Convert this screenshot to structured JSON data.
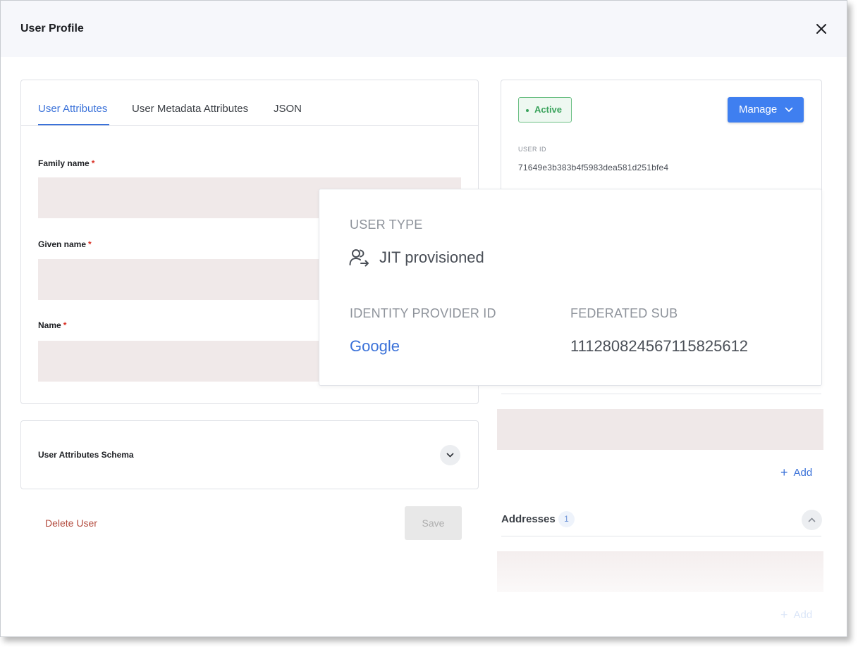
{
  "header": {
    "title": "User Profile"
  },
  "tabs": [
    {
      "label": "User Attributes",
      "active": true
    },
    {
      "label": "User Metadata Attributes",
      "active": false
    },
    {
      "label": "JSON",
      "active": false
    }
  ],
  "fields": [
    {
      "label": "Family name",
      "required_mark": "*",
      "value": ""
    },
    {
      "label": "Given name",
      "required_mark": "*",
      "value": ""
    },
    {
      "label": "Name",
      "required_mark": "*",
      "value": ""
    }
  ],
  "schema": {
    "title": "User Attributes Schema"
  },
  "actions": {
    "delete_label": "Delete User",
    "save_label": "Save"
  },
  "status": {
    "badge": "Active",
    "manage_label": "Manage"
  },
  "user": {
    "id_label": "USER ID",
    "id_value": "71649e3b383b4f5983dea581d251bfe4"
  },
  "popup": {
    "user_type_label": "USER TYPE",
    "user_type_value": "JIT provisioned",
    "idp_label": "IDENTITY PROVIDER ID",
    "idp_value": "Google",
    "fed_sub_label": "FEDERATED SUB",
    "fed_sub_value": "111280824567115825612"
  },
  "sections": {
    "add_label": "Add",
    "addresses_title": "Addresses",
    "addresses_count": "1"
  },
  "colors": {
    "accent": "#3b72d9",
    "primary_button": "#3f7ff0",
    "active_badge": "#3aa35c",
    "danger": "#b34b3e",
    "input_fill": "#f0e9e9"
  }
}
